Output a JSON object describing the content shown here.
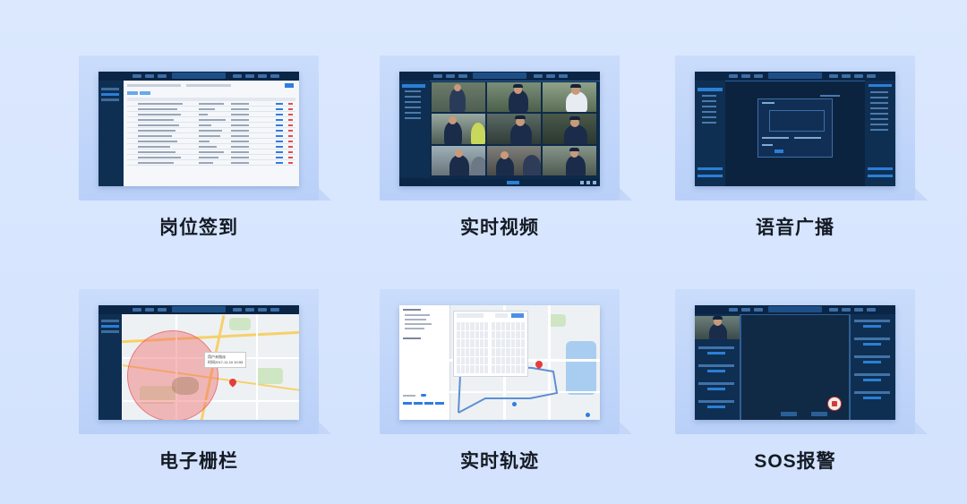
{
  "features": [
    {
      "caption": "岗位签到",
      "icon": "table-screen-icon"
    },
    {
      "caption": "实时视频",
      "icon": "video-grid-screen-icon"
    },
    {
      "caption": "语音广播",
      "icon": "broadcast-dialog-screen-icon"
    },
    {
      "caption": "电子栅栏",
      "icon": "fence-map-screen-icon"
    },
    {
      "caption": "实时轨迹",
      "icon": "track-map-screen-icon"
    },
    {
      "caption": "SOS报警",
      "icon": "sos-screen-icon"
    }
  ],
  "screens": {
    "fence_tooltip": {
      "line1": "用户未指派",
      "line2": "时间2017-11-10 10:53"
    }
  },
  "colors": {
    "page_bg": "#d8e6fe",
    "card_bg": "#c3d7fa",
    "screen_dark": "#0e2a4a",
    "fence": "#f06e6e",
    "caption_text": "#141a24"
  }
}
